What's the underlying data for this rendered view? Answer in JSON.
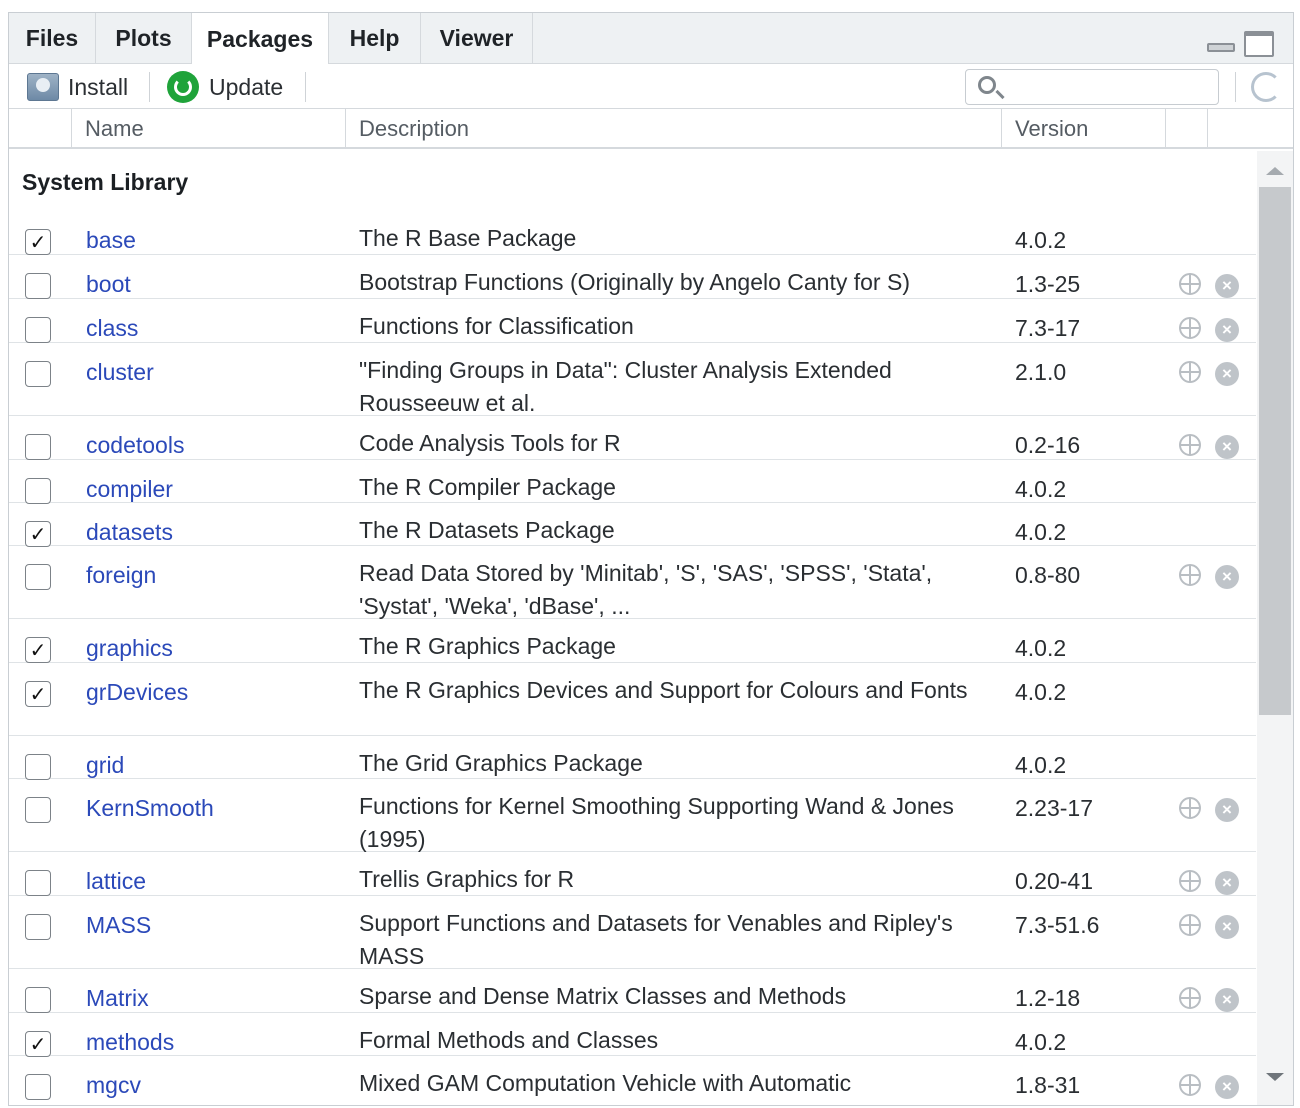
{
  "tabs": [
    {
      "label": "Files"
    },
    {
      "label": "Plots"
    },
    {
      "label": "Packages",
      "active": true
    },
    {
      "label": "Help"
    },
    {
      "label": "Viewer"
    }
  ],
  "toolbar": {
    "install_label": "Install",
    "update_label": "Update",
    "search_value": "",
    "search_placeholder": ""
  },
  "columns": {
    "name": "Name",
    "description": "Description",
    "version": "Version"
  },
  "section_title": "System Library",
  "packages": [
    {
      "name": "base",
      "description": "The R Base Package",
      "version": "4.0.2",
      "checked": true,
      "actions": false
    },
    {
      "name": "boot",
      "description": "Bootstrap Functions (Originally by Angelo Canty for S)",
      "version": "1.3-25",
      "checked": false,
      "actions": true
    },
    {
      "name": "class",
      "description": "Functions for Classification",
      "version": "7.3-17",
      "checked": false,
      "actions": true
    },
    {
      "name": "cluster",
      "description": "\"Finding Groups in Data\": Cluster Analysis Extended Rousseeuw et al.",
      "version": "2.1.0",
      "checked": false,
      "actions": true
    },
    {
      "name": "codetools",
      "description": "Code Analysis Tools for R",
      "version": "0.2-16",
      "checked": false,
      "actions": true
    },
    {
      "name": "compiler",
      "description": "The R Compiler Package",
      "version": "4.0.2",
      "checked": false,
      "actions": false
    },
    {
      "name": "datasets",
      "description": "The R Datasets Package",
      "version": "4.0.2",
      "checked": true,
      "actions": false
    },
    {
      "name": "foreign",
      "description": "Read Data Stored by 'Minitab', 'S', 'SAS', 'SPSS', 'Stata', 'Systat', 'Weka', 'dBase', ...",
      "version": "0.8-80",
      "checked": false,
      "actions": true
    },
    {
      "name": "graphics",
      "description": "The R Graphics Package",
      "version": "4.0.2",
      "checked": true,
      "actions": false
    },
    {
      "name": "grDevices",
      "description": "The R Graphics Devices and Support for Colours and Fonts",
      "version": "4.0.2",
      "checked": true,
      "actions": false
    },
    {
      "name": "grid",
      "description": "The Grid Graphics Package",
      "version": "4.0.2",
      "checked": false,
      "actions": false
    },
    {
      "name": "KernSmooth",
      "description": "Functions for Kernel Smoothing Supporting Wand & Jones (1995)",
      "version": "2.23-17",
      "checked": false,
      "actions": true
    },
    {
      "name": "lattice",
      "description": "Trellis Graphics for R",
      "version": "0.20-41",
      "checked": false,
      "actions": true
    },
    {
      "name": "MASS",
      "description": "Support Functions and Datasets for Venables and Ripley's MASS",
      "version": "7.3-51.6",
      "checked": false,
      "actions": true
    },
    {
      "name": "Matrix",
      "description": "Sparse and Dense Matrix Classes and Methods",
      "version": "1.2-18",
      "checked": false,
      "actions": true
    },
    {
      "name": "methods",
      "description": "Formal Methods and Classes",
      "version": "4.0.2",
      "checked": true,
      "actions": false
    },
    {
      "name": "mgcv",
      "description": "Mixed GAM Computation Vehicle with Automatic",
      "version": "1.8-31",
      "checked": false,
      "actions": true
    }
  ]
}
